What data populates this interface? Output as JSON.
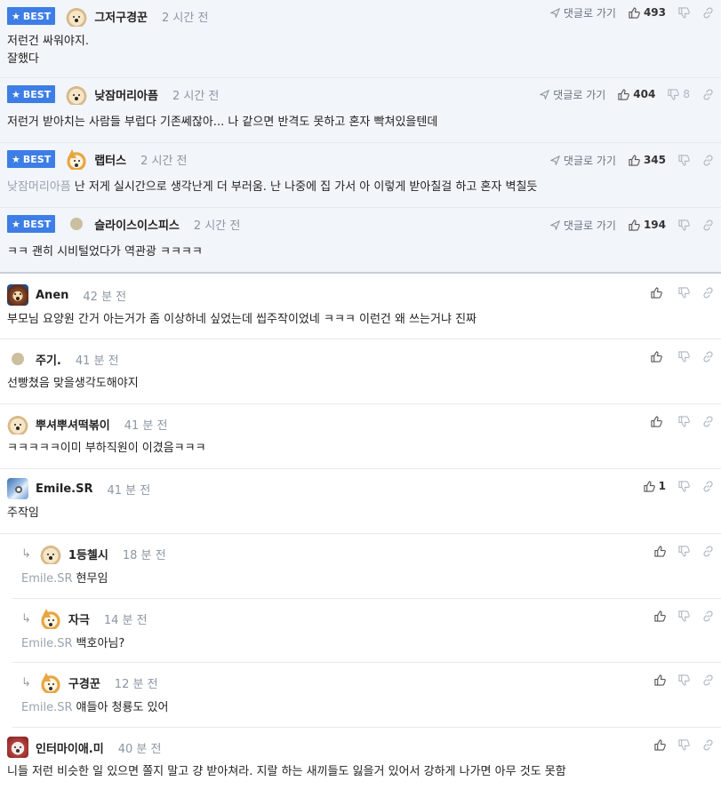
{
  "labels": {
    "best": "BEST",
    "goto_reply": "댓글로 가기"
  },
  "best_comments": [
    {
      "nick": "그저구경꾼",
      "time": "2 시간 전",
      "lines": [
        "저런건 싸워야지.",
        "잘했다"
      ],
      "likes": "493",
      "dislikes": "",
      "avatar": "puppy"
    },
    {
      "nick": "낮잠머리아픔",
      "time": "2 시간 전",
      "lines": [
        "저런거 받아치는 사람들 부럽다 기존쎄잖아... 나 같으면 반격도 못하고 혼자 빡쳐있을텐데"
      ],
      "likes": "404",
      "dislikes": "8",
      "avatar": "puppy"
    },
    {
      "nick": "랩터스",
      "time": "2 시간 전",
      "mention": "낮잠머리아픔",
      "lines": [
        "난 저게 실시간으로 생각난게 더 부러움. 난 나중에 집 가서 아 이렇게 받아칠걸 하고 혼자 벽칠듯"
      ],
      "likes": "345",
      "dislikes": "",
      "avatar": "fox"
    },
    {
      "nick": "슬라이스이스피스",
      "time": "2 시간 전",
      "lines": [
        "ㅋㅋ 괜히 시비털었다가 역관광 ㅋㅋㅋㅋ"
      ],
      "likes": "194",
      "dislikes": "",
      "avatar": "dot"
    }
  ],
  "comments": [
    {
      "nick": "Anen",
      "time": "42 분 전",
      "text": "부모님 요양원 간거 아는거가 좀 이상하네 싶었는데 씹주작이었네 ㅋㅋㅋ 이런건 왜 쓰는거냐 진짜",
      "likes": "",
      "avatar": "lion"
    },
    {
      "nick": "주기.",
      "time": "41 분 전",
      "text": "선빵쳤음 맞을생각도해야지",
      "likes": "",
      "avatar": "dot"
    },
    {
      "nick": "뿌셔뿌셔떡볶이",
      "time": "41 분 전",
      "text": "ㅋㅋㅋㅋㅋ이미 부하직원이 이겼음ㅋㅋㅋ",
      "likes": "",
      "avatar": "puppy"
    },
    {
      "nick": "Emile.SR",
      "time": "41 분 전",
      "text": "주작임",
      "likes": "1",
      "avatar": "blue"
    }
  ],
  "replies": [
    {
      "nick": "1등첼시",
      "time": "18 분 전",
      "mention": "Emile.SR",
      "text": "현무임",
      "avatar": "puppy"
    },
    {
      "nick": "자극",
      "time": "14 분 전",
      "mention": "Emile.SR",
      "text": "백호아님?",
      "avatar": "fox"
    },
    {
      "nick": "구경꾼",
      "time": "12 분 전",
      "mention": "Emile.SR",
      "text": "얘들아 청룡도 있어",
      "avatar": "fox"
    }
  ],
  "last_comment": {
    "nick": "인터마이애.미",
    "time": "40 분 전",
    "text": "니들 저런 비슷한 일 있으면 쫄지 말고 걍 받아쳐라. 지랄 하는 새끼들도 잃을거 있어서 강하게 나가면 아무 것도 못함",
    "avatar": "pink"
  }
}
